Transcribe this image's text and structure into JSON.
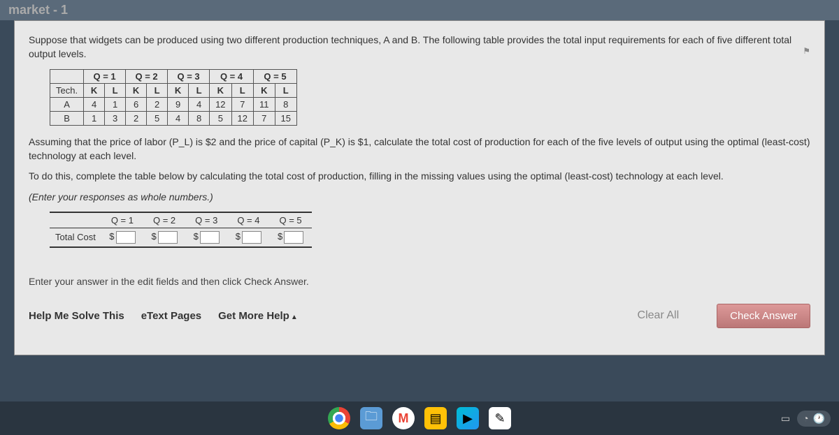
{
  "tab_title": "market - 1",
  "intro": "Suppose that widgets can be produced using two different production techniques, A and B. The following table provides the total input requirements for each of five different total output levels.",
  "table1": {
    "q_headers": [
      "Q = 1",
      "Q = 2",
      "Q = 3",
      "Q = 4",
      "Q = 5"
    ],
    "tech_label": "Tech.",
    "kl_headers": [
      "K",
      "L",
      "K",
      "L",
      "K",
      "L",
      "K",
      "L",
      "K",
      "L"
    ],
    "rows": [
      {
        "label": "A",
        "vals": [
          "4",
          "1",
          "6",
          "2",
          "9",
          "4",
          "12",
          "7",
          "11",
          "8"
        ]
      },
      {
        "label": "B",
        "vals": [
          "1",
          "3",
          "2",
          "5",
          "4",
          "8",
          "5",
          "12",
          "7",
          "15"
        ]
      }
    ]
  },
  "assumption": "Assuming that the price of labor (P_L) is $2 and the price of capital (P_K) is $1, calculate the total cost of production for each of the five levels of output using the optimal (least-cost) technology at each level.",
  "todo": "To do this, complete the table below by calculating the total cost of production, filling in the missing values using the optimal (least-cost) technology at each level.",
  "response_note": "(Enter your responses as whole numbers.)",
  "table2": {
    "headers": [
      "Q = 1",
      "Q = 2",
      "Q = 3",
      "Q = 4",
      "Q = 5"
    ],
    "row_label": "Total Cost",
    "currency": "$"
  },
  "hint": "Enter your answer in the edit fields and then click Check Answer.",
  "buttons": {
    "help_solve": "Help Me Solve This",
    "etext": "eText Pages",
    "get_more": "Get More Help",
    "clear": "Clear All",
    "check": "Check Answer"
  }
}
